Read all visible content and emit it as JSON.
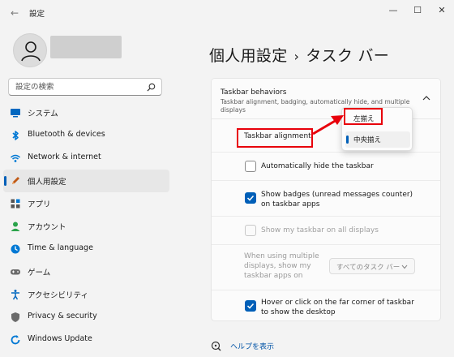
{
  "window": {
    "back_label": "←",
    "title": "設定",
    "min_label": "—",
    "max_label": "☐",
    "close_label": "✕"
  },
  "search": {
    "placeholder": "設定の検索"
  },
  "sidebar": {
    "items": [
      {
        "label": "システム",
        "icon": "monitor-icon",
        "color": "#0067c0"
      },
      {
        "label": "Bluetooth & devices",
        "icon": "bluetooth-icon",
        "color": "#0078d4"
      },
      {
        "label": "Network & internet",
        "icon": "wifi-icon",
        "color": "#0078d4"
      },
      {
        "label": "個人用設定",
        "icon": "pen-icon",
        "color": "#c05a16",
        "active": true
      },
      {
        "label": "アプリ",
        "icon": "apps-icon",
        "color": "#555555"
      },
      {
        "label": "アカウント",
        "icon": "person-icon",
        "color": "#2aa34a"
      },
      {
        "label": "Time & language",
        "icon": "globe-clock-icon",
        "color": "#0078d4"
      },
      {
        "label": "ゲーム",
        "icon": "gamepad-icon",
        "color": "#6b6b6b"
      },
      {
        "label": "アクセシビリティ",
        "icon": "accessibility-icon",
        "color": "#0067c0"
      },
      {
        "label": "Privacy & security",
        "icon": "shield-icon",
        "color": "#6b6b6b"
      },
      {
        "label": "Windows Update",
        "icon": "update-icon",
        "color": "#0078d4"
      }
    ]
  },
  "header": {
    "parent": "個人用設定",
    "separator": "›",
    "current": "タスク バー"
  },
  "section": {
    "title": "Taskbar behaviors",
    "subtitle": "Taskbar alignment, badging, automatically hide, and multiple displays"
  },
  "settings": {
    "alignment_label": "Taskbar alignment",
    "auto_hide_label": "Automatically hide the taskbar",
    "badges_label": "Show badges (unread messages counter) on taskbar apps",
    "all_displays_label": "Show my taskbar on all displays",
    "multi_display_label": "When using multiple displays, show my taskbar apps on",
    "multi_display_value": "すべてのタスク バー",
    "corner_label": "Hover or click on the far corner of taskbar to show the desktop"
  },
  "checks": {
    "auto_hide": false,
    "badges": true,
    "all_displays": false,
    "corner": true
  },
  "alignment_options": [
    "左揃え",
    "中央揃え"
  ],
  "alignment_selected": "中央揃え",
  "help": {
    "label": "ヘルプを表示"
  },
  "colors": {
    "accent": "#005fb8",
    "highlight": "#e8000b"
  }
}
